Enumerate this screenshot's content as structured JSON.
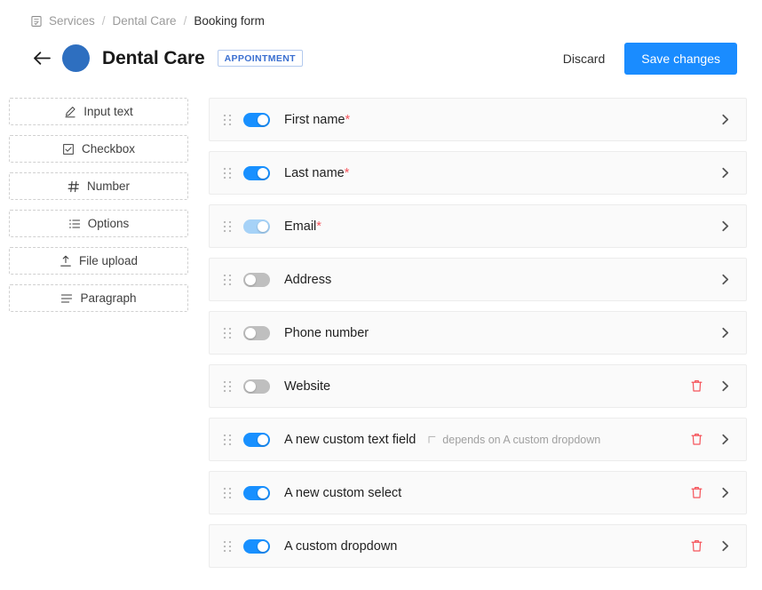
{
  "breadcrumb": {
    "icon": "form-icon",
    "items": [
      "Services",
      "Dental Care",
      "Booking form"
    ],
    "separator": "/"
  },
  "header": {
    "back_icon": "arrow-left-icon",
    "avatar": "service-avatar",
    "title": "Dental Care",
    "badge": "APPOINTMENT",
    "discard_label": "Discard",
    "save_label": "Save changes",
    "accent_color": "#1a8cff",
    "avatar_color": "#2e6fc0",
    "badge_color": "#3a6fd0"
  },
  "sidebar": {
    "items": [
      {
        "label": "Input text",
        "icon": "pencil-icon"
      },
      {
        "label": "Checkbox",
        "icon": "checkbox-icon"
      },
      {
        "label": "Number",
        "icon": "hash-icon"
      },
      {
        "label": "Options",
        "icon": "list-icon"
      },
      {
        "label": "File upload",
        "icon": "upload-icon"
      },
      {
        "label": "Paragraph",
        "icon": "paragraph-icon"
      }
    ]
  },
  "fields": {
    "toggle_on_color": "#1890ff",
    "toggle_on_muted_color": "#a6d2f7",
    "toggle_off_color": "#bfbfbf",
    "delete_color": "#f5545b",
    "required_marker": "*",
    "rows": [
      {
        "label": "First name",
        "required": true,
        "toggle": "on",
        "deletable": false,
        "dependency": ""
      },
      {
        "label": "Last name",
        "required": true,
        "toggle": "on",
        "deletable": false,
        "dependency": ""
      },
      {
        "label": "Email",
        "required": true,
        "toggle": "on-muted",
        "deletable": false,
        "dependency": ""
      },
      {
        "label": "Address",
        "required": false,
        "toggle": "off",
        "deletable": false,
        "dependency": ""
      },
      {
        "label": "Phone number",
        "required": false,
        "toggle": "off",
        "deletable": false,
        "dependency": ""
      },
      {
        "label": "Website",
        "required": false,
        "toggle": "off",
        "deletable": true,
        "dependency": ""
      },
      {
        "label": "A new custom text field",
        "required": false,
        "toggle": "on",
        "deletable": true,
        "dependency": "depends on A custom dropdown"
      },
      {
        "label": "A new custom select",
        "required": false,
        "toggle": "on",
        "deletable": true,
        "dependency": ""
      },
      {
        "label": "A custom dropdown",
        "required": false,
        "toggle": "on",
        "deletable": true,
        "dependency": ""
      }
    ]
  }
}
